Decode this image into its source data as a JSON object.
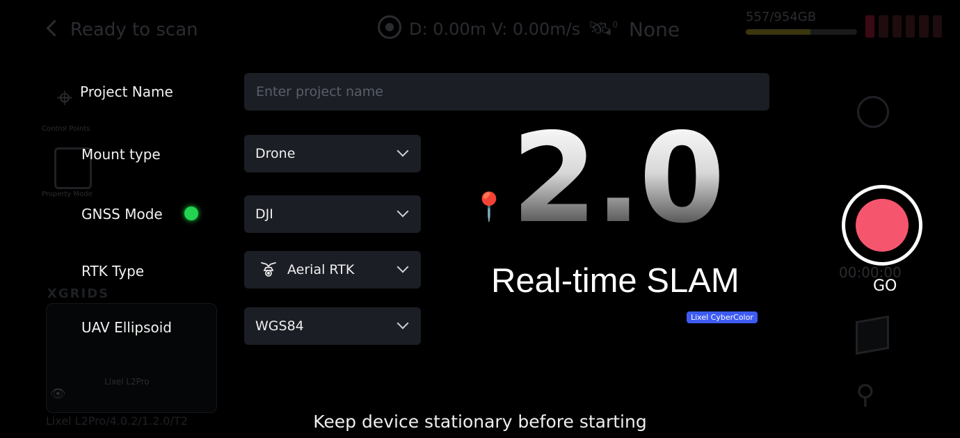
{
  "topbar": {
    "title": "Ready to scan",
    "stats": "D: 0.00m V: 0.00m/s",
    "satellite_count": "0",
    "gnss_status": "None",
    "storage": "557/954GB",
    "storage_fraction": 0.584
  },
  "background": {
    "control_points_label": "Control Points",
    "property_mode_label": "Property Mode",
    "brand_logo": "XGRIDS",
    "device_name": "Lixel L2Pro",
    "device_firmware": "Lixel L2Pro/4.0.2/1.2.0/T2",
    "timer": "00:00:00"
  },
  "form": {
    "project_name_label": "Project Name",
    "project_name_placeholder": "Enter project name",
    "project_name_value": "",
    "mount_type_label": "Mount type",
    "mount_type_value": "Drone",
    "gnss_mode_label": "GNSS Mode",
    "gnss_mode_value": "DJI",
    "gnss_status_color": "#22d44f",
    "rtk_type_label": "RTK Type",
    "rtk_type_value": "Aerial RTK",
    "uav_ellipsoid_label": "UAV Ellipsoid",
    "uav_ellipsoid_value": "WGS84"
  },
  "branding": {
    "version": "2.0",
    "subtitle": "Real-time SLAM",
    "badge": "Lixel CyberColor",
    "badge_color": "#3d5bf3"
  },
  "record": {
    "label": "GO",
    "color": "#f5566e"
  },
  "hint": "Keep device stationary before starting"
}
